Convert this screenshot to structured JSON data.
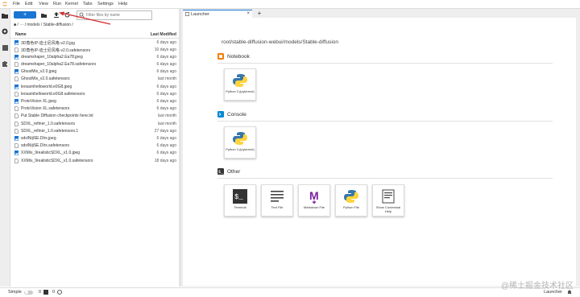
{
  "menubar": {
    "items": [
      "File",
      "Edit",
      "View",
      "Run",
      "Kernel",
      "Tabs",
      "Settings",
      "Help"
    ]
  },
  "toolbar": {
    "new_label": "+",
    "filter_placeholder": "Filter files by name"
  },
  "breadcrumb": "■ / ··· / models / Stable-diffusion /",
  "filelist": {
    "header_name": "Name",
    "header_modified": "Last Modified",
    "files": [
      {
        "name": "3D角色IP-迪士尼风格-v2.0.jpg",
        "modified": "6 days ago",
        "type": "image"
      },
      {
        "name": "3D角色IP-迪士尼风格-v2.0.safetensors",
        "modified": "10 days ago",
        "type": "file"
      },
      {
        "name": "dreamshaper_10alpha2.Ea78.jpeg",
        "modified": "6 days ago",
        "type": "image"
      },
      {
        "name": "dreamshaper_10alpha2.Ea78.safetensors",
        "modified": "6 days ago",
        "type": "file"
      },
      {
        "name": "GhostMix_v2.0.jpeg",
        "modified": "6 days ago",
        "type": "image"
      },
      {
        "name": "GhostMix_v2.0.safetensors",
        "modified": "last month",
        "type": "file"
      },
      {
        "name": "leosamhelloworld.e0G8.jpeg",
        "modified": "6 days ago",
        "type": "image"
      },
      {
        "name": "leosamhelloworld.e0G8.safetensors",
        "modified": "6 days ago",
        "type": "file"
      },
      {
        "name": "ProtoVision XL.jpeg",
        "modified": "6 days ago",
        "type": "image"
      },
      {
        "name": "ProtoVision XL.safetensors",
        "modified": "6 days ago",
        "type": "file"
      },
      {
        "name": "Put Stable Diffusion checkpoints here.txt",
        "modified": "last month",
        "type": "file"
      },
      {
        "name": "SDXL_refiner_1.0.safetensors",
        "modified": "last month",
        "type": "file"
      },
      {
        "name": "SDXL_refiner_1.0.safetensors.1",
        "modified": "27 days ago",
        "type": "file"
      },
      {
        "name": "sdxlNijiSE.Dlrx.jpeg",
        "modified": "6 days ago",
        "type": "image"
      },
      {
        "name": "sdxlNijiSE.Dlrx.safetensors",
        "modified": "6 days ago",
        "type": "file"
      },
      {
        "name": "XXMix_9realisticSDXL_v1.0.jpeg",
        "modified": "6 days ago",
        "type": "image"
      },
      {
        "name": "XXMix_9realisticSDXL_v1.0.safetensors",
        "modified": "18 days ago",
        "type": "file"
      }
    ]
  },
  "tab": {
    "label": "Launcher",
    "close": "×",
    "add": "+"
  },
  "launcher": {
    "path": "root/stable-diffusion-webui/models/Stable-diffusion",
    "notebook": {
      "title": "Notebook",
      "cards": [
        {
          "label": "Python 3 (ipykernel)"
        }
      ]
    },
    "console": {
      "title": "Console",
      "cards": [
        {
          "label": "Python 3 (ipykernel)"
        }
      ]
    },
    "other": {
      "title": "Other",
      "cards": [
        {
          "label": "Terminal",
          "art": "$_"
        },
        {
          "label": "Text File",
          "art": "lines"
        },
        {
          "label": "Markdown File",
          "art": "M"
        },
        {
          "label": "Python File",
          "art": "python"
        },
        {
          "label": "Show Contextual Help",
          "art": "help"
        }
      ]
    }
  },
  "statusbar": {
    "mode": "Simple",
    "count1": "0",
    "count2": "0",
    "right": "Launcher"
  },
  "watermark": "@稀土掘金技术社区",
  "colors": {
    "accent": "#1976d2",
    "arrow": "#d32f2f",
    "notebook_icon": "#f57c00",
    "console_icon": "#0288d1",
    "other_icon": "#333333",
    "markdown": "#7b1fa2"
  }
}
